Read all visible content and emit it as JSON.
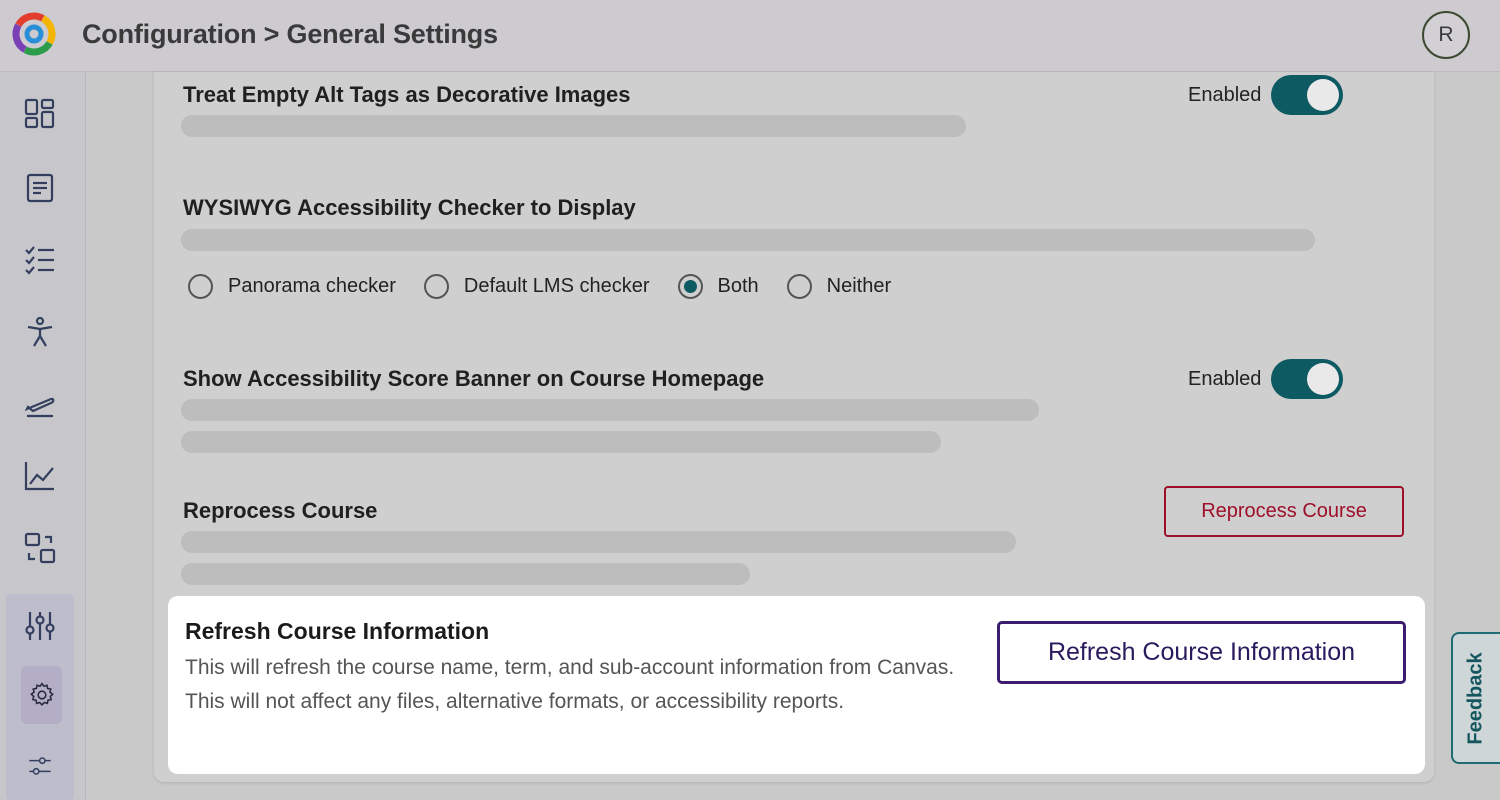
{
  "header": {
    "breadcrumb": "Configuration > General Settings",
    "avatar_initial": "R"
  },
  "sidebar": {
    "items": [
      {
        "icon": "dashboard-icon"
      },
      {
        "icon": "document-icon"
      },
      {
        "icon": "checklist-icon"
      },
      {
        "icon": "accessibility-icon"
      },
      {
        "icon": "plane-takeoff-icon"
      },
      {
        "icon": "line-chart-icon"
      },
      {
        "icon": "file-convert-icon"
      },
      {
        "icon": "sliders-icon"
      },
      {
        "icon": "gear-icon",
        "active": true
      },
      {
        "icon": "settings-adjust-icon"
      }
    ]
  },
  "settings": {
    "empty_alt": {
      "title": "Treat Empty Alt Tags as Decorative Images",
      "status": "Enabled",
      "enabled": true
    },
    "wysiwyg": {
      "title": "WYSIWYG Accessibility Checker to Display",
      "options": [
        "Panorama checker",
        "Default LMS checker",
        "Both",
        "Neither"
      ],
      "selected": "Both"
    },
    "score_banner": {
      "title": "Show Accessibility Score Banner on Course Homepage",
      "status": "Enabled",
      "enabled": true
    },
    "reprocess": {
      "title": "Reprocess Course",
      "button_label": "Reprocess Course"
    },
    "refresh": {
      "title": "Refresh Course Information",
      "description": "This will refresh the course name, term, and sub-account information from Canvas. This will not affect any files, alternative formats, or accessibility reports.",
      "button_label": "Refresh Course Information"
    }
  },
  "feedback": {
    "label": "Feedback"
  },
  "colors": {
    "toggle_on": "#0e5a63",
    "danger": "#9e0f2a",
    "primary_outline": "#3b1c6e"
  }
}
